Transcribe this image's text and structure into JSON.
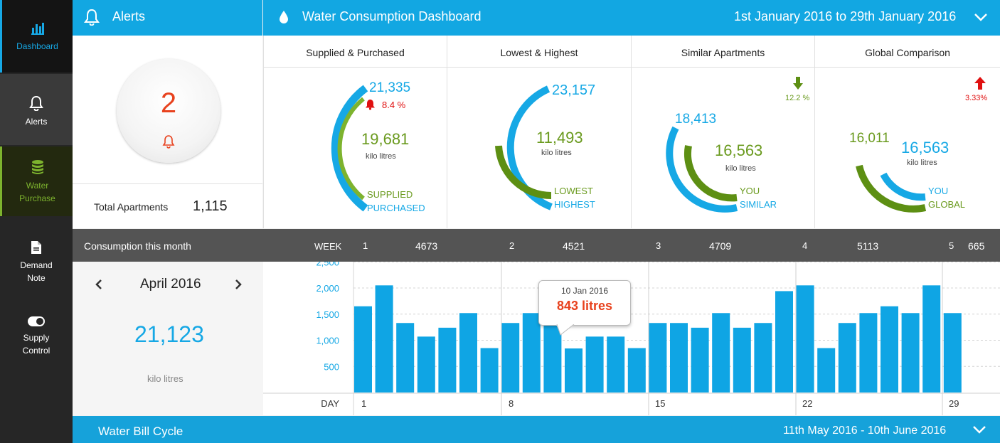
{
  "sidebar": {
    "items": [
      {
        "label": "Dashboard",
        "icon": "bar-chart-icon"
      },
      {
        "label": "Alerts",
        "icon": "bell-icon"
      },
      {
        "label": "Water Purchase",
        "label_line1": "Water",
        "label_line2": "Purchase",
        "icon": "database-icon"
      },
      {
        "label": "Demand Note",
        "label_line1": "Demand",
        "label_line2": "Note",
        "icon": "document-icon"
      },
      {
        "label": "Supply Control",
        "label_line1": "Supply",
        "label_line2": "Control",
        "icon": "toggle-icon"
      }
    ]
  },
  "alerts_bar": {
    "title": "Alerts"
  },
  "dashboard_bar": {
    "title": "Water Consumption Dashboard",
    "date_range": "1st January 2016 to 29th January 2016"
  },
  "alerts_panel": {
    "count": "2",
    "total_label": "Total Apartments",
    "total_value": "1,115"
  },
  "cards": {
    "supplied": {
      "title": "Supplied & Purchased",
      "purchased_value": "21,335",
      "change": "8.4 %",
      "supplied_value": "19,681",
      "unit": "kilo litres",
      "legend_green": "SUPPLIED",
      "legend_blue": "PURCHASED"
    },
    "lowest": {
      "title": "Lowest & Highest",
      "highest_value": "23,157",
      "lowest_value": "11,493",
      "unit": "kilo litres",
      "legend_green": "LOWEST",
      "legend_blue": "HIGHEST"
    },
    "similar": {
      "title": "Similar Apartments",
      "similar_value": "18,413",
      "you_value": "16,563",
      "change": "12.2 %",
      "unit": "kilo litres",
      "legend_green": "YOU",
      "legend_blue": "SIMILAR"
    },
    "global": {
      "title": "Global Comparison",
      "global_value": "16,011",
      "you_value": "16,563",
      "change": "3.33%",
      "unit": "kilo litres",
      "legend_blue": "YOU",
      "legend_green": "GLOBAL"
    }
  },
  "consumption": {
    "title": "Consumption this month",
    "week_label": "WEEK",
    "weeks": [
      {
        "num": "1",
        "value": "4673"
      },
      {
        "num": "2",
        "value": "4521"
      },
      {
        "num": "3",
        "value": "4709"
      },
      {
        "num": "4",
        "value": "5113"
      },
      {
        "num": "5",
        "value": "665"
      }
    ]
  },
  "month_panel": {
    "month": "April 2016",
    "value": "21,123",
    "unit": "kilo litres"
  },
  "tooltip": {
    "date": "10 Jan 2016",
    "value": "843 litres"
  },
  "bill_bar": {
    "title": "Water Bill Cycle",
    "date_range": "11th May 2016 - 10th June 2016"
  },
  "colors": {
    "accent": "#12a7e2",
    "green": "#7db32e",
    "alert": "#e8421e"
  },
  "chart_data": {
    "type": "bar",
    "ylabels": [
      "2,500",
      "2,000",
      "1,500",
      "1,000",
      "500"
    ],
    "day_label": "DAY",
    "day_ticks": [
      "1",
      "8",
      "15",
      "22",
      "29"
    ],
    "ylim": [
      0,
      2500
    ],
    "x": [
      1,
      2,
      3,
      4,
      5,
      6,
      7,
      8,
      9,
      10,
      11,
      12,
      13,
      14,
      15,
      16,
      17,
      18,
      19,
      20,
      21,
      22,
      23,
      24,
      25,
      26,
      27,
      28,
      29
    ],
    "values": [
      1650,
      2050,
      1330,
      1070,
      1240,
      1520,
      850,
      1330,
      1520,
      1330,
      843,
      1070,
      1070,
      850,
      1330,
      1330,
      1240,
      1520,
      1240,
      1330,
      1940,
      2050,
      850,
      1330,
      1520,
      1650,
      1520,
      2050,
      1520
    ]
  }
}
